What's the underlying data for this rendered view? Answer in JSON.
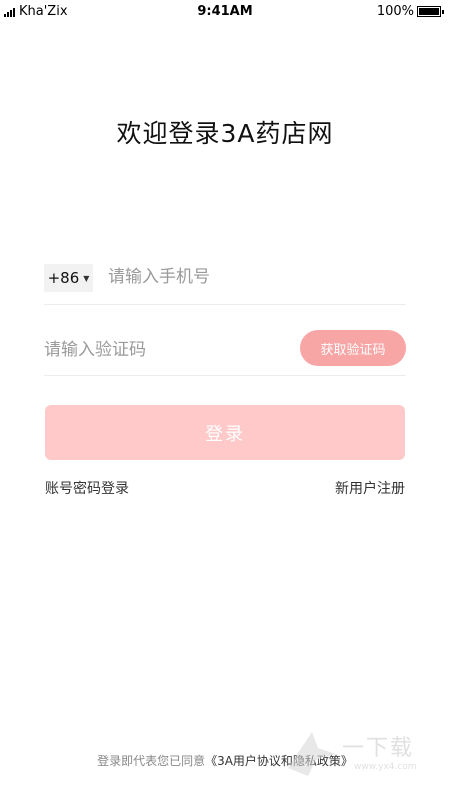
{
  "status_bar": {
    "carrier": "Kha'Zix",
    "time": "9:41AM",
    "battery": "100%"
  },
  "title": "欢迎登录3A药店网",
  "phone": {
    "country_code": "+86",
    "placeholder": "请输入手机号"
  },
  "code": {
    "placeholder": "请输入验证码",
    "get_code_label": "获取验证码"
  },
  "login_label": "登录",
  "links": {
    "password_login": "账号密码登录",
    "register": "新用户注册"
  },
  "agreement": {
    "prefix": "登录即代表您已同意",
    "policy": "《3A用户协议和隐私政策》"
  },
  "watermark": {
    "text": "一下载",
    "url": "www.yx4.com"
  },
  "colors": {
    "accent": "#f7a5a5",
    "login_button": "#ffc9c9"
  }
}
